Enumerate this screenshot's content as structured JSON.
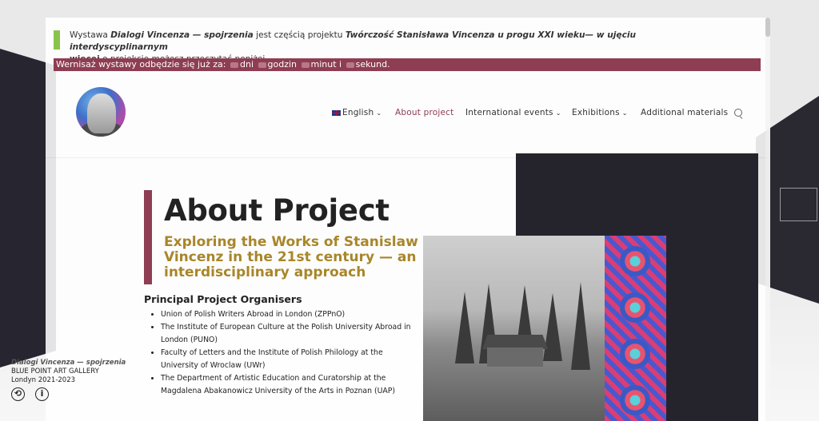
{
  "notice": {
    "prefix": "Wystawa ",
    "exhibition_title": "Dialogi Vincenza — spojrzenia",
    "middle": " jest częścią projektu ",
    "project_title": "Twórczość Stanisława Vincenza u progu XXI wieku— w ujęciu interdyscyplinarnym",
    "more_link": "więcej",
    "suffix": " o projekcie możesz przeczytać poniżej."
  },
  "countdown": {
    "lead": "Wernisaż wystawy odbędzie się już za:",
    "days_label": "dni",
    "hours_label": "godzin",
    "minutes_label": "minut i",
    "seconds_label": "sekund."
  },
  "nav": {
    "items": [
      {
        "label": "English",
        "has_menu": true
      },
      {
        "label": "About project",
        "has_menu": false,
        "active": true
      },
      {
        "label": "International events",
        "has_menu": true
      },
      {
        "label": "Exhibitions",
        "has_menu": true
      },
      {
        "label": "Additional materials",
        "has_menu": false
      }
    ]
  },
  "main": {
    "title": "About Project",
    "subtitle": "Exploring the Works of Stanislaw Vincenz in the 21st century — an interdisciplinary approach",
    "organisers_heading": "Principal Project Organisers",
    "organisers": [
      "Union of Polish Writers Abroad in London (ZPPnO)",
      "The Institute of European Culture at the Polish University Abroad in London (PUNO)",
      "Faculty of Letters and the Institute of Polish Philology at the University of Wroclaw (UWr)",
      "The Department of Artistic Education and Curatorship at the Magdalena Abakanowicz University of the Arts in Poznan (UAP)"
    ]
  },
  "gallery_caption": {
    "title": "Dialogi Vincenza — spojrzenia",
    "line2": "BLUE POINT ART GALLERY",
    "line3": "Londyn 2021-2023"
  },
  "colors": {
    "accent": "#8e3d52",
    "gold": "#a8862a",
    "notice_green": "#8bc34a"
  }
}
